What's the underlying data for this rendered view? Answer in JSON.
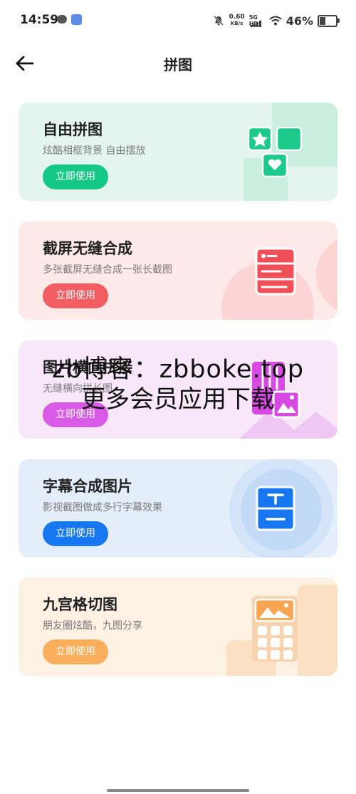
{
  "status_bar": {
    "time": "14:59",
    "speed_value": "0.60",
    "speed_unit": "KB/s",
    "network": "5G HD",
    "battery": "46%"
  },
  "header": {
    "title": "拼图"
  },
  "cards": [
    {
      "title": "自由拼图",
      "subtitle": "炫酷相框背景 自由摆放",
      "button": "立即使用",
      "bg": "#e3f5ee",
      "accent": "#14c986",
      "icon": "free-collage-icon"
    },
    {
      "title": "截屏无缝合成",
      "subtitle": "多张截屏无缝合成一张长截图",
      "button": "立即使用",
      "bg": "#fde9e8",
      "accent": "#f15d61",
      "icon": "long-screenshot-icon"
    },
    {
      "title": "图片横向拼接",
      "subtitle": "无缝横向拼长图",
      "button": "立即使用",
      "bg": "#f8e7f9",
      "accent": "#d85ae6",
      "icon": "horizontal-stitch-icon"
    },
    {
      "title": "字幕合成图片",
      "subtitle": "影视截图做成多行字幕效果",
      "button": "立即使用",
      "bg": "#e3eefa",
      "accent": "#1677f0",
      "icon": "subtitle-icon"
    },
    {
      "title": "九宫格切图",
      "subtitle": "朋友圈炫酷，九图分享",
      "button": "立即使用",
      "bg": "#fdf1e4",
      "accent": "#f9ae5c",
      "icon": "nine-grid-icon"
    }
  ],
  "watermark": {
    "line1": "zb博客：zbboke.top",
    "line2": "更多会员应用下载"
  }
}
